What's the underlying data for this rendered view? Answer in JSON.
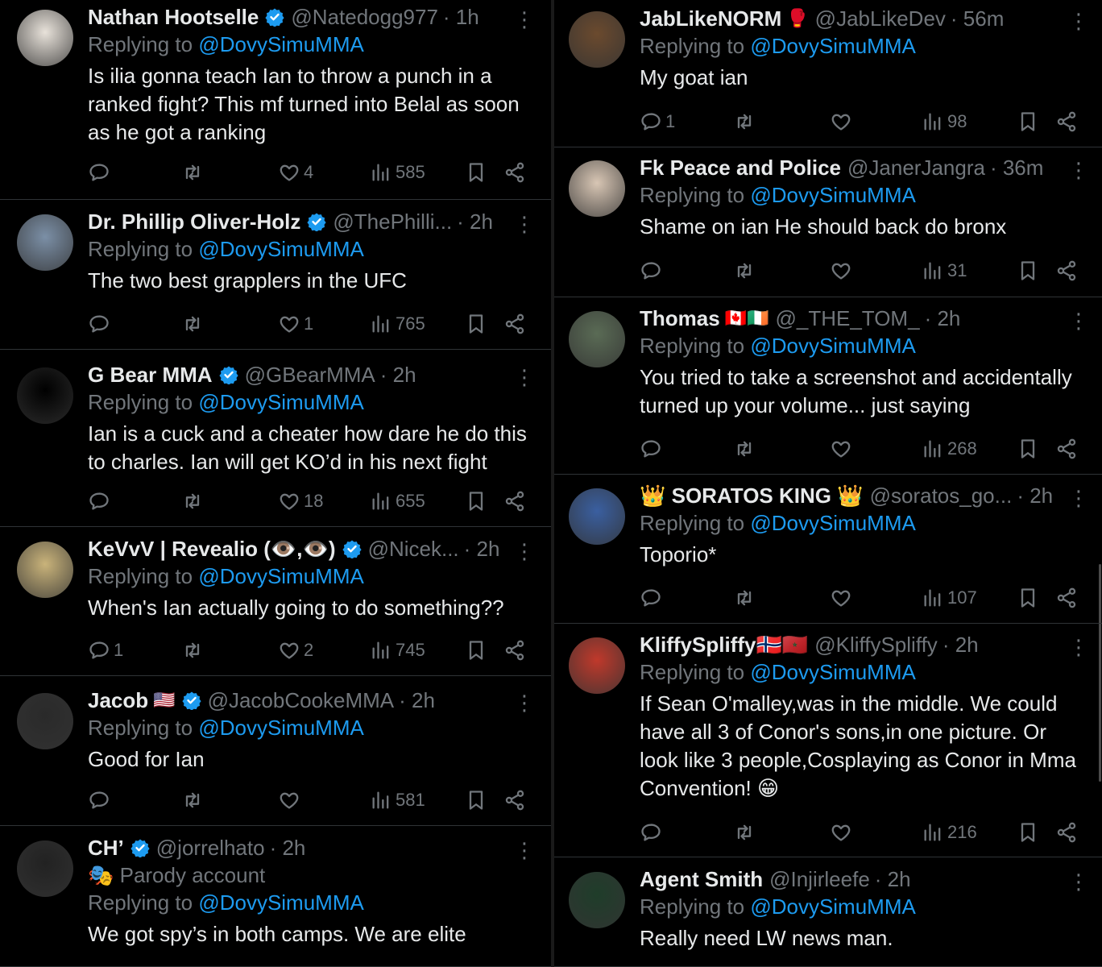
{
  "left": [
    {
      "name": "Nathan Hootselle",
      "verified": true,
      "handle": "@Natedogg977",
      "time": "· 1h",
      "replying_prefix": "Replying to ",
      "replying_to": "@DovySimuMMA",
      "text": "Is ilia gonna teach Ian to throw a punch in a ranked fight? This mf turned into Belal as soon as he got a ranking",
      "replies": "",
      "retweets": "",
      "likes": "4",
      "views": "585",
      "avatar_color": "#e8e2da"
    },
    {
      "name": "Dr. Phillip Oliver-Holz",
      "verified": true,
      "handle": "@ThePhilli...",
      "time": "· 2h",
      "replying_prefix": "Replying to ",
      "replying_to": "@DovySimuMMA",
      "text": "The two best grapplers in the UFC",
      "replies": "",
      "retweets": "",
      "likes": "1",
      "views": "765",
      "avatar_color": "#7b8fa6"
    },
    {
      "name": "G Bear MMA",
      "verified": true,
      "handle": "@GBearMMA",
      "time": "· 2h",
      "replying_prefix": "Replying to ",
      "replying_to": "@DovySimuMMA",
      "text": "Ian is a cuck and a cheater how dare he do this to charles. Ian will get KO’d in his next fight",
      "replies": "",
      "retweets": "",
      "likes": "18",
      "views": "655",
      "avatar_color": "#000000"
    },
    {
      "name": "KeVvV | Revealio (👁️,👁️)",
      "verified": true,
      "handle": "@Nicek...",
      "time": "· 2h",
      "replying_prefix": "Replying to ",
      "replying_to": "@DovySimuMMA",
      "text": "When's Ian actually going to do something??",
      "replies": "1",
      "retweets": "",
      "likes": "2",
      "views": "745",
      "avatar_color": "#c9b37a"
    },
    {
      "name": "Jacob",
      "flag": "🇺🇸",
      "verified": true,
      "handle": "@JacobCookeMMA",
      "time": "· 2h",
      "replying_prefix": "Replying to ",
      "replying_to": "@DovySimuMMA",
      "text": "Good for Ian",
      "replies": "",
      "retweets": "",
      "likes": "",
      "views": "581",
      "avatar_color": "#2a2a2a"
    },
    {
      "name": "CH’",
      "verified": true,
      "handle": "@jorrelhato",
      "time": "· 2h",
      "parody": "🎭 Parody account",
      "replying_prefix": "Replying to ",
      "replying_to": "@DovySimuMMA",
      "text": "We got spy’s in both camps. We are elite",
      "avatar_color": "#222222"
    }
  ],
  "right": [
    {
      "name": "JabLikeNORM",
      "flag": "🥊",
      "verified": false,
      "handle": "@JabLikeDev",
      "time": "· 56m",
      "replying_prefix": "Replying to ",
      "replying_to": "@DovySimuMMA",
      "text": "My goat ian",
      "replies": "1",
      "retweets": "",
      "likes": "",
      "views": "98",
      "avatar_color": "#6b4a2e"
    },
    {
      "name": "Fk Peace and Police",
      "verified": false,
      "handle": "@JanerJangra",
      "time": "· 36m",
      "replying_prefix": "Replying to ",
      "replying_to": "@DovySimuMMA",
      "text": "Shame on ian He should back do bronx",
      "replies": "",
      "retweets": "",
      "likes": "",
      "views": "31",
      "avatar_color": "#d8c6b4"
    },
    {
      "name": "Thomas",
      "flag": "🇨🇦🇮🇪",
      "verified": false,
      "handle": "@_THE_TOM_",
      "time": "· 2h",
      "replying_prefix": "Replying to ",
      "replying_to": "@DovySimuMMA",
      "text": "You tried to take a screenshot and accidentally turned up your volume... just saying",
      "replies": "",
      "retweets": "",
      "likes": "",
      "views": "268",
      "avatar_color": "#5a6b55"
    },
    {
      "name": "👑 SORATOS KING 👑",
      "verified": false,
      "handle": "@soratos_go...",
      "time": "· 2h",
      "replying_prefix": "Replying to ",
      "replying_to": "@DovySimuMMA",
      "text": "Toporio*",
      "replies": "",
      "retweets": "",
      "likes": "",
      "views": "107",
      "avatar_color": "#3a5fa0"
    },
    {
      "name": "KliffySpliffy🇳🇴🇲🇦",
      "verified": false,
      "handle": "@KliffySpliffy",
      "time": "· 2h",
      "replying_prefix": "Replying to ",
      "replying_to": "@DovySimuMMA",
      "text": "If Sean O'malley,was in the middle. We could have all 3 of Conor's sons,in one picture.  Or look like 3 people,Cosplaying as Conor in Mma Convention! 😁",
      "replies": "",
      "retweets": "",
      "likes": "",
      "views": "216",
      "avatar_color": "#c0392b"
    },
    {
      "name": "Agent Smith",
      "verified": false,
      "handle": "@Injirleefe",
      "time": "· 2h",
      "replying_prefix": "Replying to ",
      "replying_to": "@DovySimuMMA",
      "text": "Really need LW news man.",
      "avatar_color": "#1f3d2a"
    }
  ],
  "colors": {
    "accent": "#1d9bf0",
    "muted": "#71767b",
    "text": "#e7e9ea",
    "border": "#2f3336"
  },
  "icons": [
    "reply-icon",
    "retweet-icon",
    "like-icon",
    "views-icon",
    "bookmark-icon",
    "share-icon",
    "verified-badge-icon",
    "more-icon"
  ]
}
